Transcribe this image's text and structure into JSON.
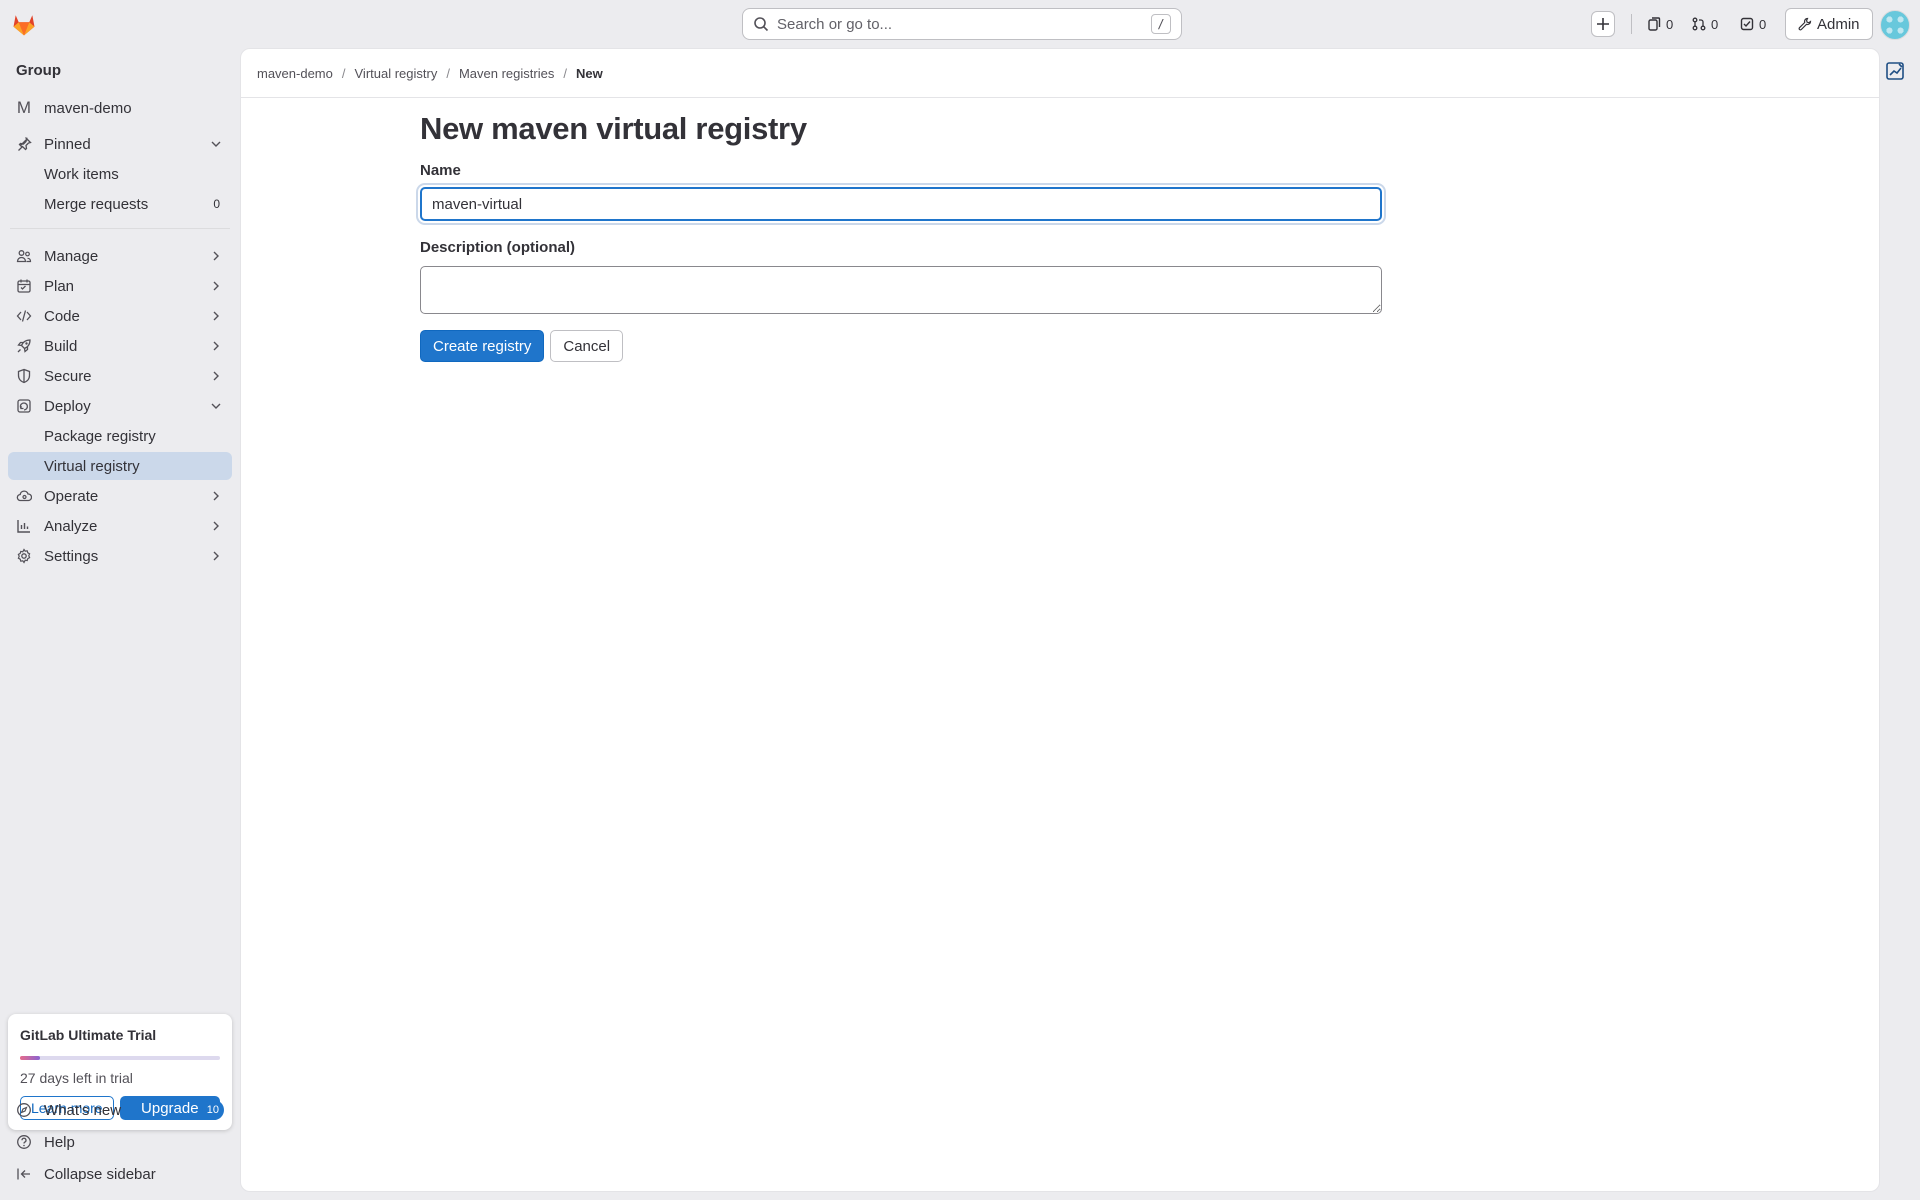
{
  "topbar": {
    "search_placeholder": "Search or go to...",
    "search_shortcut": "/",
    "issues_count": "0",
    "merge_requests_count": "0",
    "todos_count": "0",
    "admin_label": "Admin"
  },
  "sidebar": {
    "context_title": "Group",
    "group_initial": "M",
    "group_name": "maven-demo",
    "pinned": {
      "label": "Pinned",
      "items": [
        {
          "label": "Work items"
        },
        {
          "label": "Merge requests",
          "count": "0"
        }
      ]
    },
    "sections": [
      {
        "label": "Manage"
      },
      {
        "label": "Plan"
      },
      {
        "label": "Code"
      },
      {
        "label": "Build"
      },
      {
        "label": "Secure"
      },
      {
        "label": "Deploy"
      },
      {
        "label": "Operate"
      },
      {
        "label": "Analyze"
      },
      {
        "label": "Settings"
      }
    ],
    "deploy_items": [
      {
        "label": "Package registry"
      },
      {
        "label": "Virtual registry"
      }
    ],
    "trial": {
      "title": "GitLab Ultimate Trial",
      "days_left": "27 days left in trial",
      "progress": 0.1,
      "learn_more": "Learn more",
      "upgrade": "Upgrade"
    },
    "footer": {
      "whats_new": "What's new",
      "whats_new_count": "10",
      "help": "Help",
      "collapse": "Collapse sidebar"
    }
  },
  "breadcrumb": {
    "items": [
      "maven-demo",
      "Virtual registry",
      "Maven registries",
      "New"
    ]
  },
  "form": {
    "title": "New maven virtual registry",
    "name_label": "Name",
    "name_value": "maven-virtual",
    "description_label": "Description (optional)",
    "description_value": "",
    "create_button": "Create registry",
    "cancel_button": "Cancel"
  },
  "colors": {
    "accent": "#1f75cb",
    "active_nav": "#cbd8ea",
    "page_bg": "#ececef"
  }
}
